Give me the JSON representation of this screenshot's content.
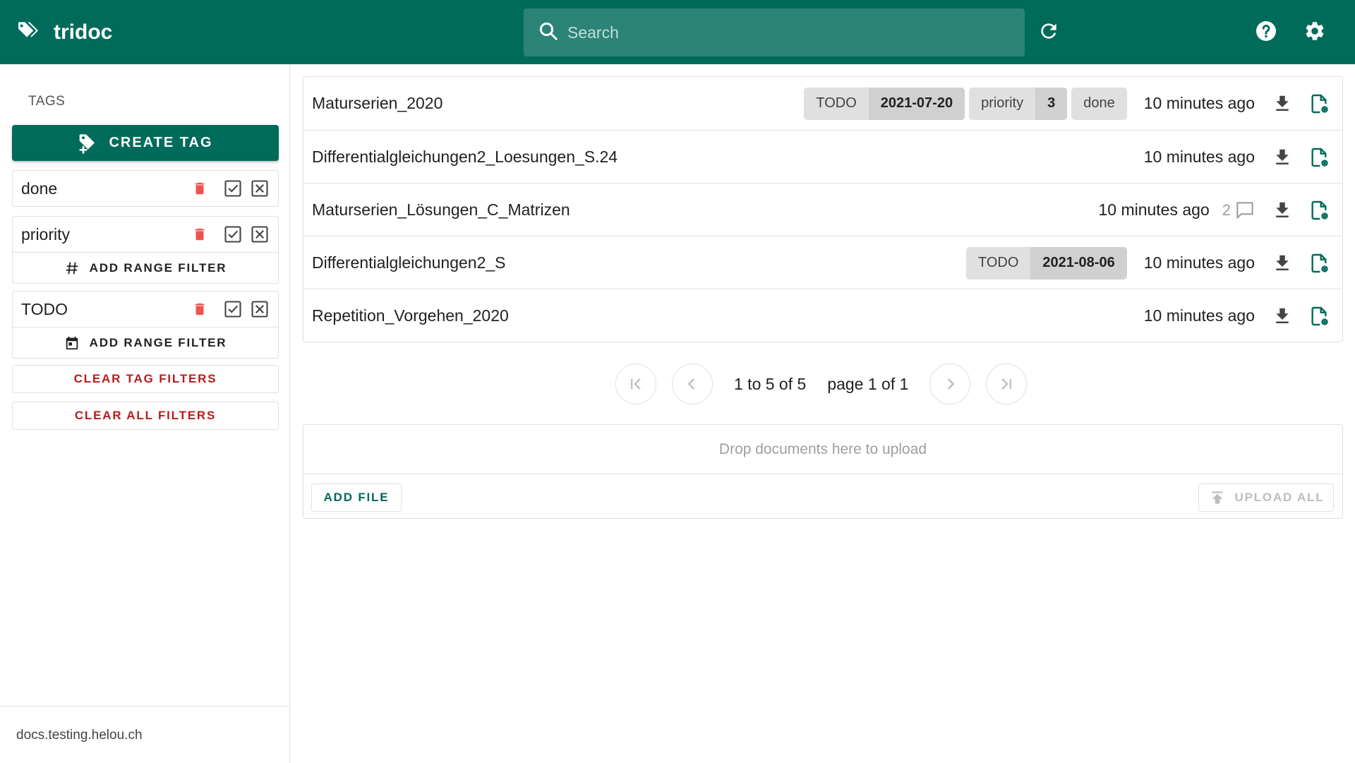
{
  "header": {
    "app_name": "tridoc",
    "search_placeholder": "Search"
  },
  "sidebar": {
    "title": "TAGS",
    "create_tag_label": "CREATE TAG",
    "tags": [
      {
        "name": "done"
      },
      {
        "name": "priority",
        "range_filter_label": "ADD RANGE FILTER"
      },
      {
        "name": "TODO",
        "range_filter_label": "ADD RANGE FILTER"
      }
    ],
    "clear_tag_filters_label": "CLEAR TAG FILTERS",
    "clear_all_filters_label": "CLEAR ALL FILTERS",
    "footer_host": "docs.testing.helou.ch"
  },
  "documents": [
    {
      "title": "Maturserien_2020",
      "chips": [
        {
          "key": "TODO",
          "value": "2021-07-20"
        },
        {
          "key": "priority",
          "value": "3"
        },
        {
          "key": "done"
        }
      ],
      "time": "10 minutes ago"
    },
    {
      "title": "Differentialgleichungen2_Loesungen_S.24",
      "time": "10 minutes ago"
    },
    {
      "title": "Maturserien_Lösungen_C_Matrizen",
      "time": "10 minutes ago",
      "comment_count": "2"
    },
    {
      "title": "Differentialgleichungen2_S",
      "chips": [
        {
          "key": "TODO",
          "value": "2021-08-06"
        }
      ],
      "time": "10 minutes ago"
    },
    {
      "title": "Repetition_Vorgehen_2020",
      "time": "10 minutes ago"
    }
  ],
  "pagination": {
    "range_text": "1 to 5 of 5",
    "page_text": "page 1 of 1"
  },
  "upload": {
    "drop_text": "Drop documents here to upload",
    "add_file_label": "ADD FILE",
    "upload_all_label": "UPLOAD ALL"
  },
  "colors": {
    "primary": "#006b5b",
    "danger": "#b71c1c",
    "delete_icon": "#ef5350"
  }
}
